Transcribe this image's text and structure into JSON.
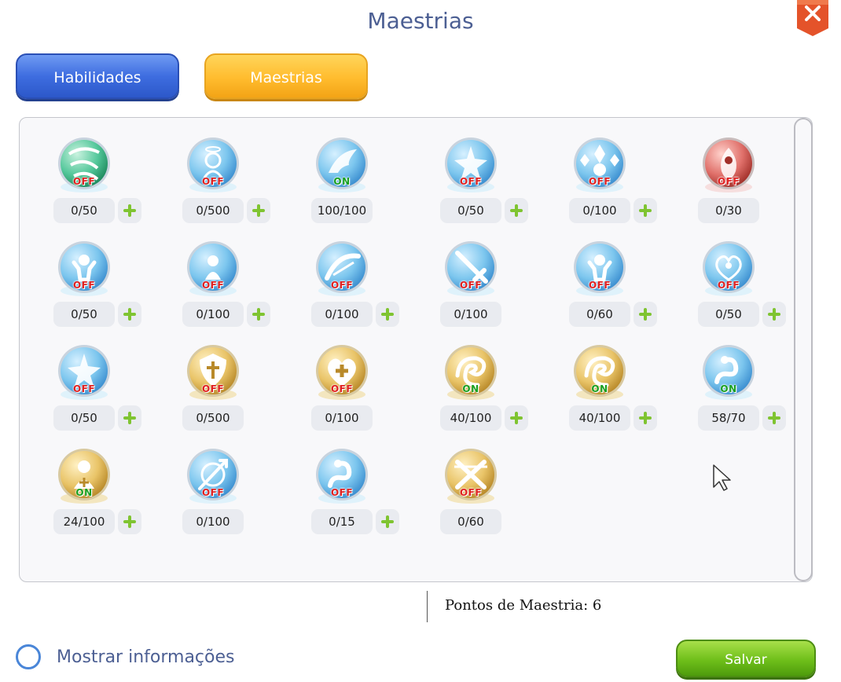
{
  "window": {
    "title": "Maestrias",
    "close_icon": "close-icon"
  },
  "tabs": [
    {
      "label": "Habilidades",
      "active": false,
      "color": "#3e6de0"
    },
    {
      "label": "Maestrias",
      "active": true,
      "color": "#ffbc2e"
    }
  ],
  "masteries": [
    {
      "icon": "green-rune-icon",
      "theme": "green",
      "status": "OFF",
      "level": "0/50",
      "can_add": true
    },
    {
      "icon": "angel-halo-icon",
      "theme": "blue",
      "status": "OFF",
      "level": "0/500",
      "can_add": true
    },
    {
      "icon": "feather-wing-icon",
      "theme": "blue",
      "status": "ON",
      "level": "100/100",
      "can_add": false
    },
    {
      "icon": "star-burst-icon",
      "theme": "blue",
      "status": "OFF",
      "level": "0/50",
      "can_add": true
    },
    {
      "icon": "diamond-orb-icon",
      "theme": "blue",
      "status": "OFF",
      "level": "0/100",
      "can_add": true
    },
    {
      "icon": "flame-figure-icon",
      "theme": "red",
      "status": "OFF",
      "level": "0/30",
      "can_add": false
    },
    {
      "icon": "strength-figure-icon",
      "theme": "blue",
      "status": "OFF",
      "level": "0/50",
      "can_add": true
    },
    {
      "icon": "figure-icon",
      "theme": "blue",
      "status": "OFF",
      "level": "0/100",
      "can_add": true
    },
    {
      "icon": "slash-arc-icon",
      "theme": "blue",
      "status": "OFF",
      "level": "0/100",
      "can_add": true
    },
    {
      "icon": "sword-icon",
      "theme": "blue",
      "status": "OFF",
      "level": "0/100",
      "can_add": false
    },
    {
      "icon": "strength-figure-icon",
      "theme": "blue",
      "status": "OFF",
      "level": "0/60",
      "can_add": true
    },
    {
      "icon": "heart-crest-icon",
      "theme": "blue",
      "status": "OFF",
      "level": "0/50",
      "can_add": true
    },
    {
      "icon": "star-burst-icon",
      "theme": "blue",
      "status": "OFF",
      "level": "0/50",
      "can_add": true
    },
    {
      "icon": "holy-shield-icon",
      "theme": "gold",
      "status": "OFF",
      "level": "0/500",
      "can_add": false
    },
    {
      "icon": "heart-cross-icon",
      "theme": "gold",
      "status": "OFF",
      "level": "0/100",
      "can_add": false
    },
    {
      "icon": "dragon-swirl-icon",
      "theme": "gold",
      "status": "ON",
      "level": "40/100",
      "can_add": true
    },
    {
      "icon": "dragon-swirl-icon",
      "theme": "gold",
      "status": "ON",
      "level": "40/100",
      "can_add": true
    },
    {
      "icon": "serpent-icon",
      "theme": "blue",
      "status": "ON",
      "level": "58/70",
      "can_add": true
    },
    {
      "icon": "healer-figure-icon",
      "theme": "gold",
      "status": "ON",
      "level": "24/100",
      "can_add": true
    },
    {
      "icon": "arrow-swirl-icon",
      "theme": "blue",
      "status": "OFF",
      "level": "0/100",
      "can_add": false
    },
    {
      "icon": "serpent-icon",
      "theme": "blue",
      "status": "OFF",
      "level": "0/15",
      "can_add": true
    },
    {
      "icon": "crossed-blades-icon",
      "theme": "gold",
      "status": "OFF",
      "level": "0/60",
      "can_add": false
    }
  ],
  "footer": {
    "points_label": "Pontos de Maestria: 6",
    "show_info_label": "Mostrar informações",
    "save_label": "Salvar"
  },
  "colors": {
    "title": "#4c5f93",
    "status_on": "#18a020",
    "status_off": "#e02020",
    "plus": "#7fc431",
    "save": "#6fbf1a"
  }
}
